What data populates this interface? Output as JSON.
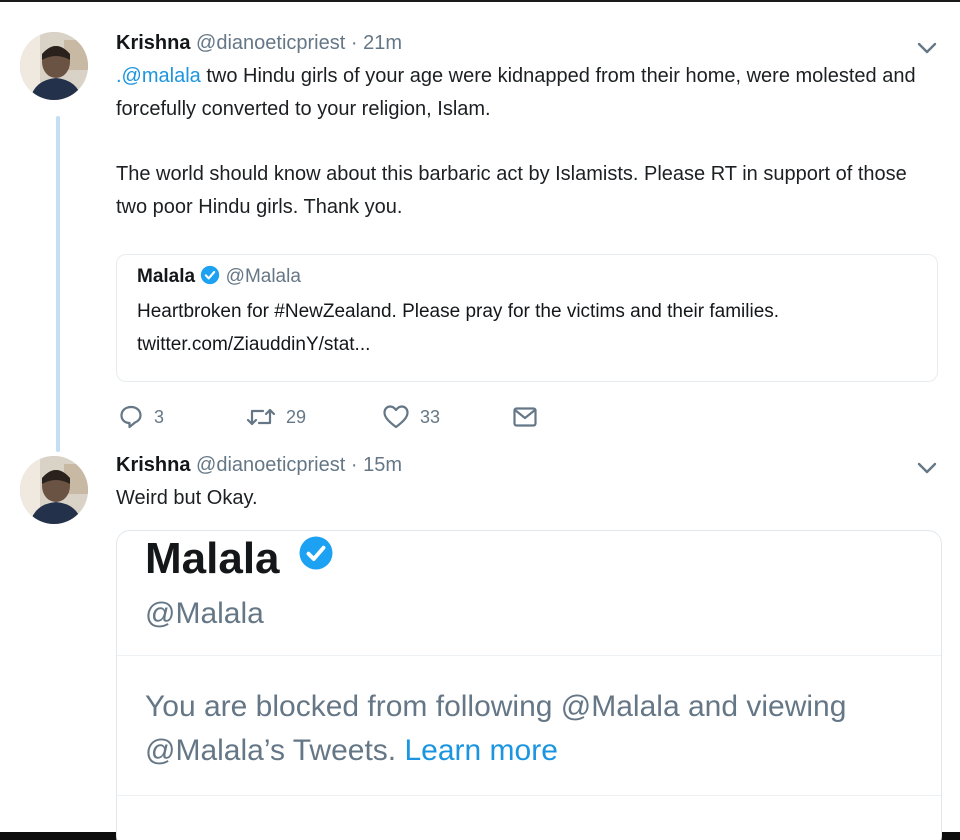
{
  "colors": {
    "link": "#1b95e0",
    "muted": "#657786",
    "text": "#14171a",
    "thread_line": "#c4dff5",
    "verified": "#1da1f2"
  },
  "tweet1": {
    "name": "Krishna",
    "handle": "@dianoeticpriest",
    "dot": "·",
    "time": "21m",
    "mention": ".@malala",
    "text_line1": " two Hindu girls of your age were kidnapped from their home, were molested and forcefully converted to your religion, Islam.",
    "paragraph2": "The world should know about this barbaric act by Islamists. Please RT in support of those two poor Hindu girls. Thank you.",
    "quote": {
      "name": "Malala",
      "handle": "@Malala",
      "text": "Heartbroken for #NewZealand. Please pray for the victims and their families.",
      "link": "twitter.com/ZiauddinY/stat..."
    },
    "actions": {
      "replies": "3",
      "retweets": "29",
      "likes": "33"
    },
    "icons": [
      "reply-icon",
      "retweet-icon",
      "like-icon",
      "message-icon",
      "chevron-down-icon",
      "verified-badge-icon"
    ]
  },
  "tweet2": {
    "name": "Krishna",
    "handle": "@dianoeticpriest",
    "dot": "·",
    "time": "15m",
    "text": "Weird but Okay.",
    "card": {
      "name": "Malala",
      "handle": "@Malala",
      "message": "You are blocked from following @Malala and viewing @Malala’s Tweets.",
      "learn_more": "Learn more"
    }
  }
}
